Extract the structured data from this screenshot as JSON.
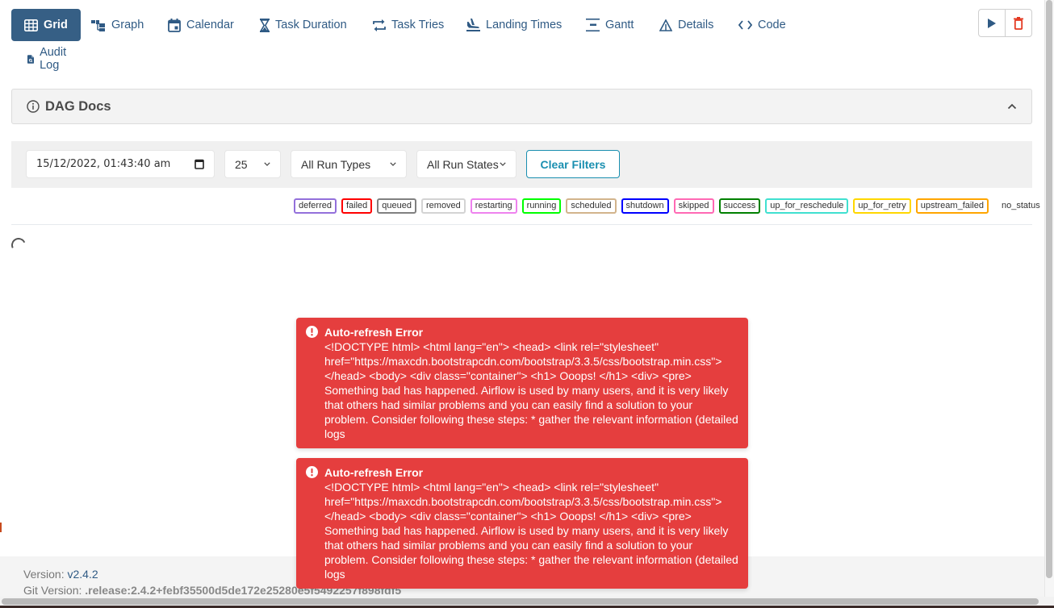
{
  "nav": {
    "items": [
      {
        "label": "Grid",
        "icon": "grid-icon",
        "active": true
      },
      {
        "label": "Graph",
        "icon": "graph-icon"
      },
      {
        "label": "Calendar",
        "icon": "calendar-icon"
      },
      {
        "label": "Task Duration",
        "icon": "hourglass-icon"
      },
      {
        "label": "Task Tries",
        "icon": "repeat-icon"
      },
      {
        "label": "Landing Times",
        "icon": "plane-landing-icon"
      },
      {
        "label": "Gantt",
        "icon": "gantt-icon"
      },
      {
        "label": "Details",
        "icon": "warning-triangle-icon"
      },
      {
        "label": "Code",
        "icon": "code-icon"
      },
      {
        "label": "Audit Log",
        "icon": "file-search-icon"
      }
    ],
    "actions": {
      "trigger": {
        "icon": "play-icon",
        "color": "#2f5a84"
      },
      "delete": {
        "icon": "trash-icon",
        "color": "#e43921"
      }
    }
  },
  "docs": {
    "title": "DAG Docs",
    "icon": "info-icon"
  },
  "filters": {
    "datetime": "15/12/2022, 01:43:40 am",
    "num_runs": "25",
    "run_type": "All Run Types",
    "run_state": "All Run States",
    "clear_label": "Clear Filters"
  },
  "legend": [
    {
      "label": "deferred",
      "color": "#9370db"
    },
    {
      "label": "failed",
      "color": "#ff0000"
    },
    {
      "label": "queued",
      "color": "#808080"
    },
    {
      "label": "removed",
      "color": "#d3d3d3"
    },
    {
      "label": "restarting",
      "color": "#ee82ee"
    },
    {
      "label": "running",
      "color": "#00ff00"
    },
    {
      "label": "scheduled",
      "color": "#d2b48c"
    },
    {
      "label": "shutdown",
      "color": "#0000ff"
    },
    {
      "label": "skipped",
      "color": "#ff69b4"
    },
    {
      "label": "success",
      "color": "#008000"
    },
    {
      "label": "up_for_reschedule",
      "color": "#40e0d0"
    },
    {
      "label": "up_for_retry",
      "color": "#ffd700"
    },
    {
      "label": "upstream_failed",
      "color": "#ffa500"
    },
    {
      "label": "no_status",
      "color": null
    }
  ],
  "toasts": [
    {
      "title": "Auto-refresh Error",
      "body": "<!DOCTYPE html> <html lang=\"en\"> <head> <link rel=\"stylesheet\" href=\"https://maxcdn.bootstrapcdn.com/bootstrap/3.3.5/css/bootstrap.min.css\"> </head> <body> <div class=\"container\"> <h1> Ooops! </h1> <div> <pre> Something bad has happened. Airflow is used by many users, and it is very likely that others had similar problems and you can easily find a solution to your problem. Consider following these steps: * gather the relevant information (detailed logs"
    },
    {
      "title": "Auto-refresh Error",
      "body": "<!DOCTYPE html> <html lang=\"en\"> <head> <link rel=\"stylesheet\" href=\"https://maxcdn.bootstrapcdn.com/bootstrap/3.3.5/css/bootstrap.min.css\"> </head> <body> <div class=\"container\"> <h1> Ooops! </h1> <div> <pre> Something bad has happened. Airflow is used by many users, and it is very likely that others had similar problems and you can easily find a solution to your problem. Consider following these steps: * gather the relevant information (detailed logs"
    }
  ],
  "footer": {
    "version_label": "Version:",
    "version": "v2.4.2",
    "git_label": "Git Version:",
    "git_version": ".release:2.4.2+febf35500d5de172e25280e5f5492257f898fdf5"
  }
}
